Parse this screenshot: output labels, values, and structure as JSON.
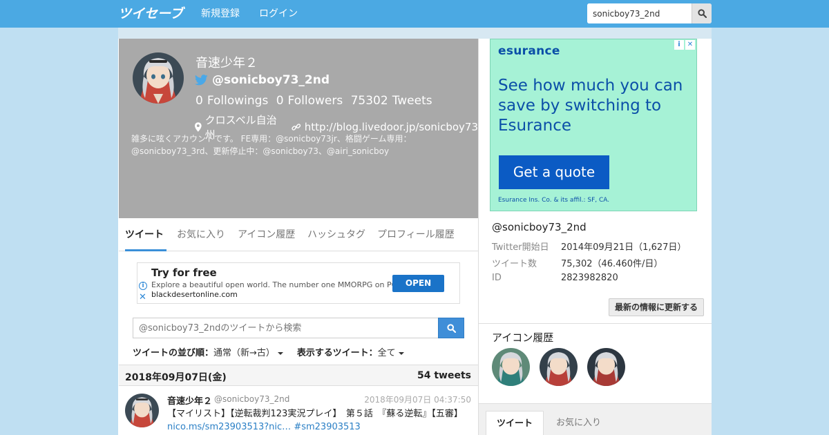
{
  "nav": {
    "logo_text": "ツイセーブ",
    "register": "新規登録",
    "login": "ログイン",
    "search_value": "sonicboy73_2nd"
  },
  "profile": {
    "name": "音速少年２",
    "screen_name": "@sonicboy73_2nd",
    "followings_count": "0",
    "followings_label": "Followings",
    "followers_count": "0",
    "followers_label": "Followers",
    "tweets_count": "75302",
    "tweets_label": "Tweets",
    "location": "クロスベル自治州",
    "url": "http://blog.livedoor.jp/sonicboy73",
    "description": "雑多に呟くアカウントです。 FE専用：@sonicboy73jr、格闘ゲーム専用：@sonicboy73_3rd、更新停止中：@sonicboy73、@airi_sonicboy"
  },
  "tabs": [
    "ツイート",
    "お気に入り",
    "アイコン履歴",
    "ハッシュタグ",
    "プロフィール履歴"
  ],
  "ad_top": {
    "title": "Try for free",
    "desc": "Explore a beautiful open world. The number one MMORPG on PC",
    "url": "blackdesertonline.com",
    "button": "OPEN"
  },
  "tweet_search": {
    "placeholder": "@sonicboy73_2ndのツイートから検索"
  },
  "sort": {
    "order_label": "ツイートの並び順：",
    "order_value": "通常（新→古）",
    "show_label": "表示するツイート：",
    "show_value": "全て"
  },
  "day": {
    "date": "2018年09月07日(金)",
    "count": "54 tweets"
  },
  "tweet": {
    "name": "音速少年２",
    "screen_name": "@sonicboy73_2nd",
    "time": "2018年09月07日 04:37:50",
    "text_part1": "【マイリスト】【逆転裁判123実況プレイ】　第５話　『蘇る逆転』【五審】",
    "link1": "nico.ms/sm23903513?nic…",
    "link2": "#sm23903513"
  },
  "ad_right": {
    "logo": "esurance",
    "headline": "See how much you can save by switching to Esurance",
    "button": "Get a quote",
    "footer": "Esurance Ins. Co. & its affil.: SF, CA."
  },
  "info": {
    "screen_name": "@sonicboy73_2nd",
    "started_label": "Twitter開始日",
    "started_value": "2014年09月21日（1,627日）",
    "tweets_label": "ツイート数",
    "tweets_value": "75,302（46.460件/日）",
    "id_label": "ID",
    "id_value": "2823982820",
    "refresh": "最新の情報に更新する"
  },
  "icon_history_title": "アイコン履歴",
  "right_tabs": [
    "ツイート",
    "お気に入り"
  ],
  "colors": {
    "nav_bg": "#4ba9e3",
    "page_bg": "#bfdff2",
    "profile_bg": "#a9a9a9",
    "accent": "#3a8fd8",
    "ad_bg": "#a6f2d6"
  }
}
